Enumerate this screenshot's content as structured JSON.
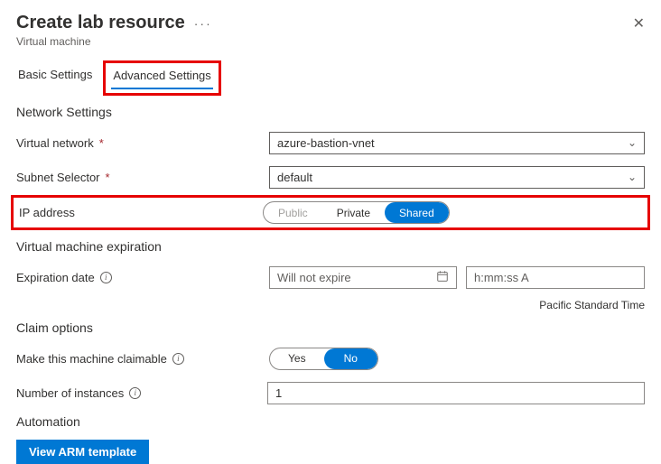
{
  "header": {
    "title": "Create lab resource",
    "subtitle": "Virtual machine"
  },
  "tabs": {
    "basic": "Basic Settings",
    "advanced": "Advanced Settings"
  },
  "sections": {
    "network": "Network Settings",
    "expiration": "Virtual machine expiration",
    "claim": "Claim options",
    "automation": "Automation"
  },
  "labels": {
    "vnet": "Virtual network",
    "subnet": "Subnet Selector",
    "ip": "IP address",
    "expDate": "Expiration date",
    "claimable": "Make this machine claimable",
    "instances": "Number of instances"
  },
  "values": {
    "vnet": "azure-bastion-vnet",
    "subnet": "default",
    "expDate": "Will not expire",
    "expTime": "h:mm:ss A",
    "tz": "Pacific Standard Time",
    "instances": "1"
  },
  "ipOptions": {
    "public": "Public",
    "private": "Private",
    "shared": "Shared"
  },
  "claimOptions": {
    "yes": "Yes",
    "no": "No"
  },
  "buttons": {
    "viewArm": "View ARM template"
  }
}
